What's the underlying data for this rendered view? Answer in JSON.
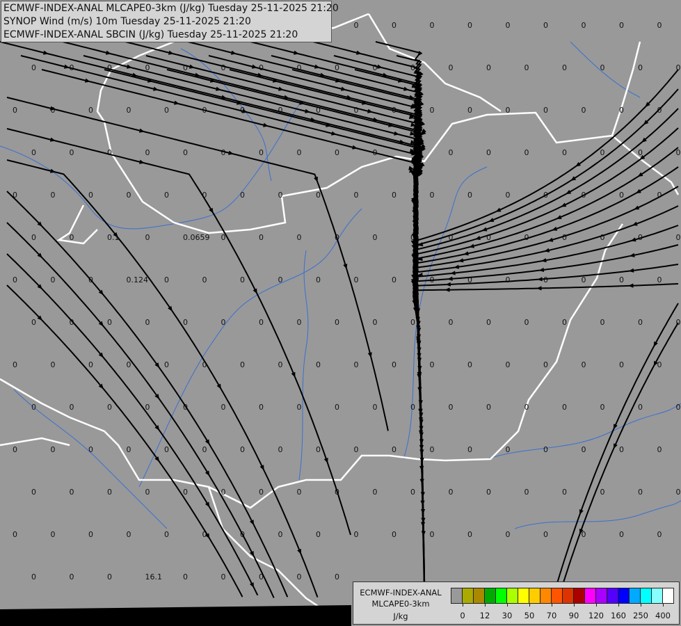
{
  "titles": [
    "ECMWF-INDEX-ANAL MLCAPE0-3km (J/kg) Tuesday 25-11-2025 21:20",
    "SYNOP Wind (m/s) 10m Tuesday 25-11-2025 21:20",
    "ECMWF-INDEX-ANAL SBCIN (J/kg) Tuesday 25-11-2025 21:20"
  ],
  "colors": {
    "background": "#999999",
    "border": "#ffffff",
    "river": "#3a6fd0",
    "streamline": "#000000"
  },
  "legend": {
    "model": "ECMWF-INDEX-ANAL",
    "param": "MLCAPE0-3km",
    "unit": "J/kg",
    "colors": [
      "#999999",
      "#aaaa00",
      "#aa8800",
      "#00aa00",
      "#00ff00",
      "#aaff00",
      "#ffff00",
      "#ffcc00",
      "#ff8800",
      "#ff5500",
      "#dd3300",
      "#aa0000",
      "#ff00ff",
      "#aa00ff",
      "#5500ff",
      "#0000ff",
      "#00aaff",
      "#00ffff",
      "#88ffff",
      "#ffffff"
    ],
    "tick_labels": [
      "0",
      "12",
      "30",
      "50",
      "70",
      "90",
      "120",
      "160",
      "250",
      "400"
    ]
  },
  "sbcin_labels": {
    "default": "0",
    "special": [
      {
        "row": 5,
        "col": 2,
        "value": "0.1"
      },
      {
        "row": 5,
        "col": 4,
        "value": "0.0659"
      },
      {
        "row": 6,
        "col": 3,
        "value": "0.124"
      },
      {
        "row": 13,
        "col": 3,
        "value": "16.1"
      }
    ]
  }
}
